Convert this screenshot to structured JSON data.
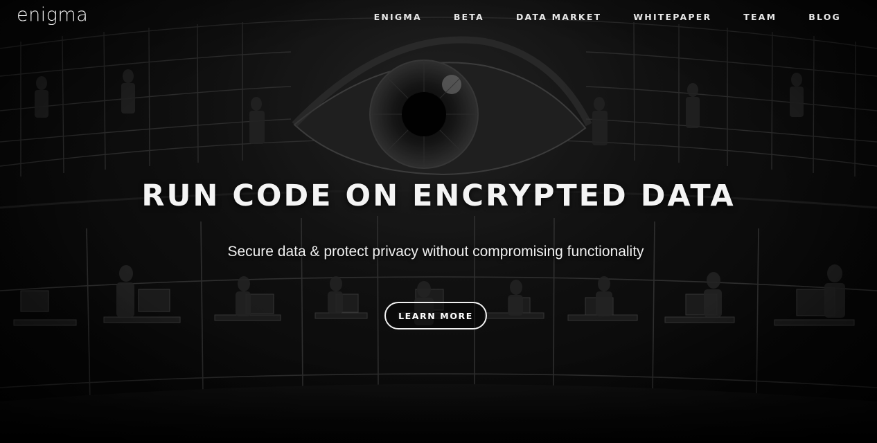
{
  "brand": {
    "logo_text": "enigma"
  },
  "nav": {
    "items": [
      {
        "label": "ENIGMA"
      },
      {
        "label": "BETA"
      },
      {
        "label": "DATA MARKET"
      },
      {
        "label": "WHITEPAPER"
      },
      {
        "label": "TEAM"
      },
      {
        "label": "BLOG"
      }
    ]
  },
  "hero": {
    "headline": "RUN CODE ON ENCRYPTED DATA",
    "subheadline": "Secure data & protect privacy without compromising functionality",
    "cta_label": "LEARN MORE",
    "illustration": "panopticon-eye-illustration"
  },
  "colors": {
    "background": "#0a0a0a",
    "text": "#f4f4f4",
    "button_border": "#f0f0f0"
  }
}
